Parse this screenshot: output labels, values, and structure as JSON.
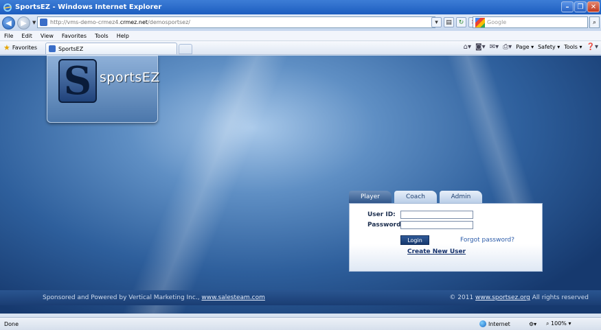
{
  "window": {
    "title": "SportsEZ - Windows Internet Explorer"
  },
  "address": {
    "url_prefix": "http://vms-demo-crmez4.",
    "url_domain": "crmez.net",
    "url_suffix": "/demosportsez/",
    "search_placeholder": "Google"
  },
  "menu": {
    "items": [
      "File",
      "Edit",
      "View",
      "Favorites",
      "Tools",
      "Help"
    ]
  },
  "favbar": {
    "favorites_label": "Favorites",
    "tab_title": "SportsEZ",
    "commands": [
      "Page ▾",
      "Safety ▾",
      "Tools ▾"
    ]
  },
  "site": {
    "logo_text": "sportsEZ",
    "tabs": [
      "Player",
      "Coach",
      "Admin"
    ],
    "user_id_label": "User ID:",
    "password_label": "Password:",
    "login_label": "Login",
    "forgot_label": "Forgot password?",
    "create_label": "Create New User",
    "footer_left_text": "Sponsored and Powered by Vertical Marketing Inc., ",
    "footer_left_link": "www.salesteam.com",
    "footer_right_prefix": "© 2011 ",
    "footer_right_link": "www.sportsez.org",
    "footer_right_suffix": " All rights reserved"
  },
  "status": {
    "text": "Done",
    "zone": "Internet",
    "zoom": "100%"
  },
  "colors": {
    "titlebar": "#1c5dbf",
    "page_bg": "#2e5f9c",
    "footer": "#1a3d73"
  }
}
